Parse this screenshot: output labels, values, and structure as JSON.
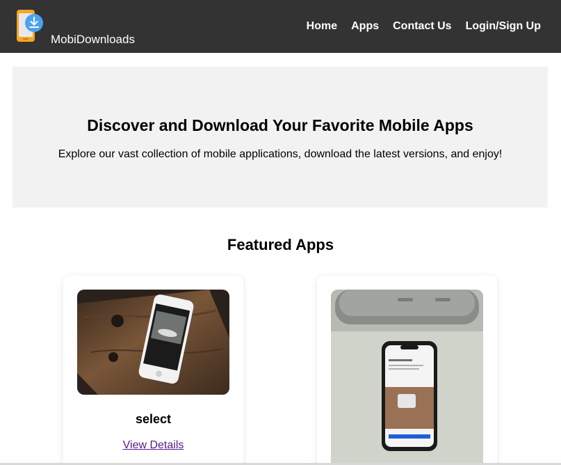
{
  "header": {
    "brand": "MobiDownloads",
    "logo_icon": "phone-download-icon",
    "nav": [
      "Home",
      "Apps",
      "Contact Us",
      "Login/Sign Up"
    ]
  },
  "hero": {
    "title": "Discover and Download Your Favorite Mobile Apps",
    "subtitle": "Explore our vast collection of mobile applications, download the latest versions, and enjoy!"
  },
  "featured": {
    "title": "Featured Apps",
    "apps": [
      {
        "name": "select",
        "link": "View Details"
      },
      {
        "name": "",
        "link": ""
      }
    ]
  },
  "colors": {
    "header_bg": "#333333",
    "hero_bg": "#f2f2f2",
    "link": "#551a8b"
  }
}
